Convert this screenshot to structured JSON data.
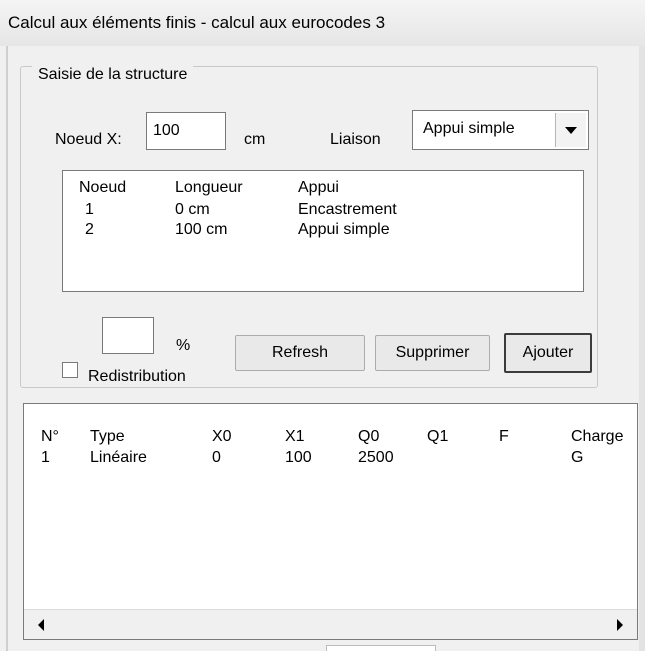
{
  "window": {
    "title": "Calcul aux éléments finis - calcul aux eurocodes 3"
  },
  "structure": {
    "legend": "Saisie de la structure",
    "node_label": "Noeud X:",
    "node_value": "100",
    "node_unit": "cm",
    "liaison_label": "Liaison",
    "liaison_value": "Appui simple",
    "nodes_table": {
      "headers": [
        "Noeud",
        "Longueur",
        "Appui"
      ],
      "rows": [
        [
          "1",
          "0 cm",
          "Encastrement"
        ],
        [
          "2",
          "100 cm",
          "Appui simple"
        ]
      ]
    },
    "percent_value": "",
    "percent_unit": "%",
    "redistribution_label": "Redistribution",
    "redistribution_checked": false,
    "buttons": {
      "refresh": "Refresh",
      "delete": "Supprimer",
      "add": "Ajouter"
    }
  },
  "loads": {
    "headers": [
      "N°",
      "Type",
      "X0",
      "X1",
      "Q0",
      "Q1",
      "F",
      "Charge"
    ],
    "rows": [
      [
        "1",
        "Linéaire",
        "0",
        "100",
        "2500",
        "",
        "",
        "G"
      ]
    ]
  },
  "icons": {
    "combo_arrow": "chevron-down-icon",
    "scroll_left": "arrow-left-icon",
    "scroll_right": "arrow-right-icon"
  }
}
